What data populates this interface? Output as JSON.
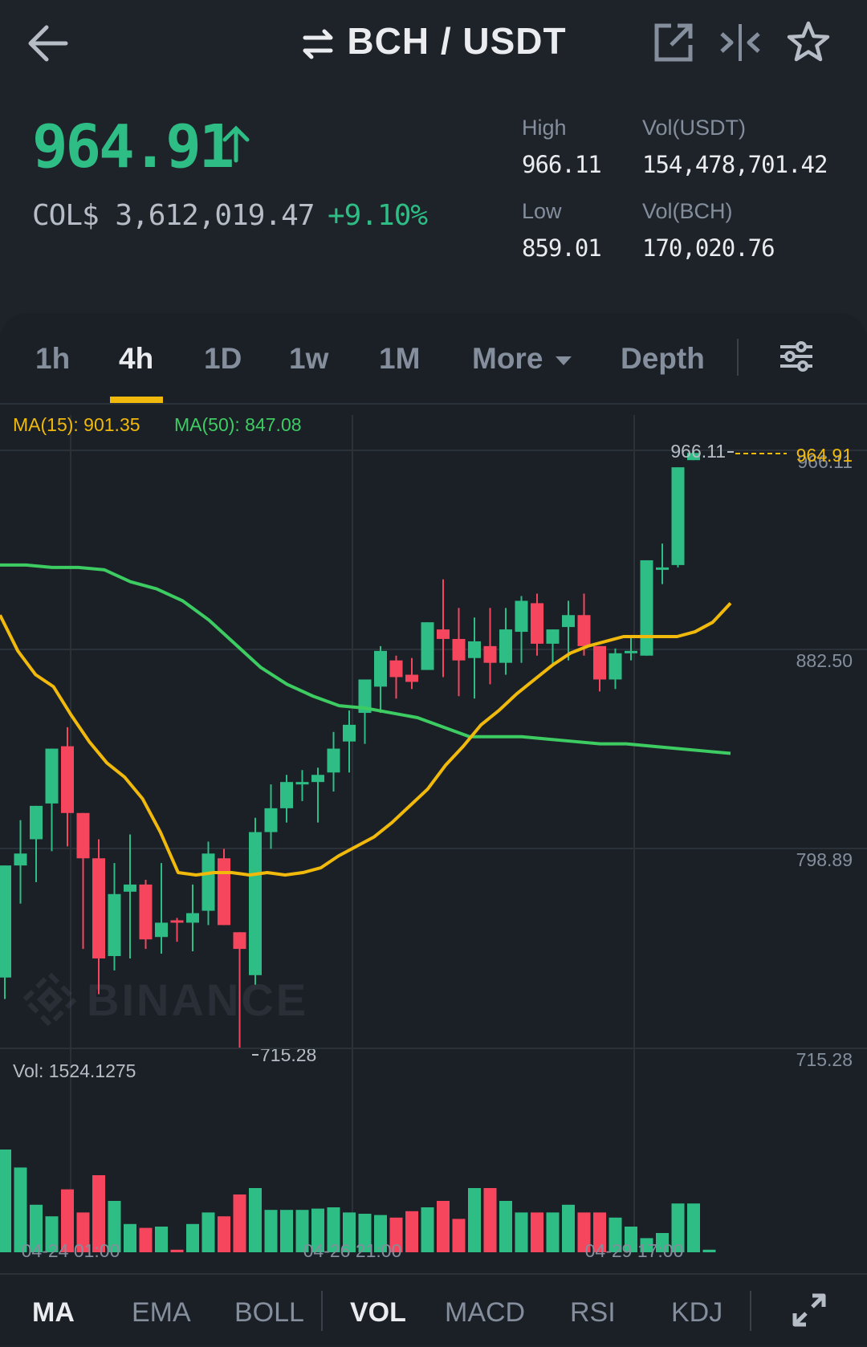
{
  "header": {
    "pair": "BCH / USDT",
    "icons": [
      "back-arrow-icon",
      "swap-icon",
      "external-link-icon",
      "split-compare-icon",
      "star-icon"
    ]
  },
  "ticker": {
    "last_price": "964.91",
    "fiat_value": "COL$ 3,612,019.47",
    "change_pct": "+9.10%",
    "high_label": "High",
    "high": "966.11",
    "low_label": "Low",
    "low": "859.01",
    "vol_quote_label": "Vol(USDT)",
    "vol_quote": "154,478,701.42",
    "vol_base_label": "Vol(BCH)",
    "vol_base": "170,020.76"
  },
  "intervals": {
    "h1": "1h",
    "h4": "4h",
    "d1": "1D",
    "w1": "1w",
    "m1": "1M",
    "more": "More",
    "depth": "Depth",
    "selected": "4h"
  },
  "indicators": {
    "ma": "MA",
    "ema": "EMA",
    "boll": "BOLL",
    "vol": "VOL",
    "macd": "MACD",
    "rsi": "RSI",
    "kdj": "KDJ"
  },
  "colors": {
    "up": "#2ebd85",
    "down": "#f6465d",
    "ma15": "#f0b90b",
    "ma50": "#3dcc62",
    "background": "#1b2027"
  },
  "chart_data": {
    "type": "candlestick",
    "interval": "4h",
    "ma_legend": {
      "ma15_label": "MA(15): 901.35",
      "ma50_label": "MA(50): 847.08"
    },
    "price_axis_ticks": [
      "966.11",
      "882.50",
      "798.89",
      "715.28"
    ],
    "ylim": [
      715.28,
      966.11
    ],
    "high_marker": "966.11",
    "low_marker": "715.28",
    "last_price_marker": "964.91",
    "watermark": "BINANCE",
    "time_labels": [
      "04-24 01:00",
      "04-26 21:00",
      "04-29 17:00"
    ],
    "volume_label": "Vol: 1524.1275",
    "candles": [
      {
        "o": 745,
        "h": 786,
        "l": 736,
        "c": 792
      },
      {
        "o": 792,
        "h": 811,
        "l": 776,
        "c": 797
      },
      {
        "o": 803,
        "h": 813,
        "l": 785,
        "c": 817
      },
      {
        "o": 818,
        "h": 841,
        "l": 798,
        "c": 841
      },
      {
        "o": 842,
        "h": 850,
        "l": 800,
        "c": 814
      },
      {
        "o": 814,
        "h": 806,
        "l": 757,
        "c": 795
      },
      {
        "o": 795,
        "h": 803,
        "l": 738,
        "c": 753
      },
      {
        "o": 754,
        "h": 793,
        "l": 748,
        "c": 780
      },
      {
        "o": 781,
        "h": 805,
        "l": 753,
        "c": 784
      },
      {
        "o": 784,
        "h": 786,
        "l": 757,
        "c": 761
      },
      {
        "o": 762,
        "h": 793,
        "l": 755,
        "c": 768
      },
      {
        "o": 769,
        "h": 770,
        "l": 760,
        "c": 768
      },
      {
        "o": 768,
        "h": 784,
        "l": 756,
        "c": 772
      },
      {
        "o": 773,
        "h": 802,
        "l": 767,
        "c": 797
      },
      {
        "o": 795,
        "h": 799,
        "l": 768,
        "c": 767
      },
      {
        "o": 764,
        "h": 757,
        "l": 715,
        "c": 757
      },
      {
        "o": 746,
        "h": 812,
        "l": 742,
        "c": 806
      },
      {
        "o": 806,
        "h": 826,
        "l": 799,
        "c": 816
      },
      {
        "o": 816,
        "h": 830,
        "l": 810,
        "c": 827
      },
      {
        "o": 827,
        "h": 832,
        "l": 819,
        "c": 827
      },
      {
        "o": 827,
        "h": 833,
        "l": 810,
        "c": 830
      },
      {
        "o": 831,
        "h": 848,
        "l": 823,
        "c": 841
      },
      {
        "o": 844,
        "h": 857,
        "l": 831,
        "c": 851
      },
      {
        "o": 856,
        "h": 862,
        "l": 843,
        "c": 870
      },
      {
        "o": 867,
        "h": 884,
        "l": 856,
        "c": 882
      },
      {
        "o": 878,
        "h": 880,
        "l": 862,
        "c": 871
      },
      {
        "o": 872,
        "h": 879,
        "l": 866,
        "c": 869
      },
      {
        "o": 874,
        "h": 894,
        "l": 874,
        "c": 894
      },
      {
        "o": 891,
        "h": 912,
        "l": 871,
        "c": 887
      },
      {
        "o": 887,
        "h": 900,
        "l": 863,
        "c": 878
      },
      {
        "o": 879,
        "h": 896,
        "l": 862,
        "c": 886
      },
      {
        "o": 884,
        "h": 900,
        "l": 868,
        "c": 877
      },
      {
        "o": 877,
        "h": 900,
        "l": 872,
        "c": 891
      },
      {
        "o": 890,
        "h": 905,
        "l": 877,
        "c": 903
      },
      {
        "o": 902,
        "h": 906,
        "l": 880,
        "c": 885
      },
      {
        "o": 885,
        "h": 882,
        "l": 876,
        "c": 891
      },
      {
        "o": 892,
        "h": 903,
        "l": 878,
        "c": 897
      },
      {
        "o": 897,
        "h": 906,
        "l": 880,
        "c": 884
      },
      {
        "o": 884,
        "h": 872,
        "l": 865,
        "c": 870
      },
      {
        "o": 870,
        "h": 883,
        "l": 866,
        "c": 881
      },
      {
        "o": 881,
        "h": 888,
        "l": 878,
        "c": 882
      },
      {
        "o": 880,
        "h": 912,
        "l": 880,
        "c": 920
      },
      {
        "o": 917,
        "h": 927,
        "l": 910,
        "c": 917
      },
      {
        "o": 918,
        "h": 958,
        "l": 917,
        "c": 959
      },
      {
        "o": 962,
        "h": 966,
        "l": 962,
        "c": 965
      }
    ],
    "ma15": [
      897,
      882,
      872,
      867,
      855,
      844,
      835,
      829,
      820,
      806,
      789,
      788,
      789,
      789,
      788,
      789,
      788,
      789,
      791,
      796,
      800,
      804,
      810,
      817,
      824,
      834,
      842,
      851,
      857,
      864,
      870,
      876,
      881,
      884,
      886,
      888,
      888,
      888,
      888,
      890,
      894,
      902
    ],
    "ma50": [
      918,
      918,
      917,
      917,
      916,
      911,
      908,
      903,
      895,
      885,
      875,
      868,
      863,
      859,
      858,
      856,
      854,
      850,
      846,
      846,
      846,
      845,
      844,
      843,
      843,
      842,
      841,
      840,
      839
    ],
    "volume": [
      0.8,
      0.66,
      0.37,
      0.28,
      0.49,
      0.31,
      0.6,
      0.4,
      0.22,
      0.19,
      0.2,
      0.02,
      0.22,
      0.31,
      0.28,
      0.45,
      0.5,
      0.33,
      0.33,
      0.33,
      0.34,
      0.35,
      0.31,
      0.3,
      0.29,
      0.27,
      0.32,
      0.35,
      0.4,
      0.26,
      0.5,
      0.5,
      0.4,
      0.31,
      0.31,
      0.31,
      0.37,
      0.31,
      0.31,
      0.27,
      0.2,
      0.11,
      0.15,
      0.38,
      0.38,
      0.02
    ]
  }
}
